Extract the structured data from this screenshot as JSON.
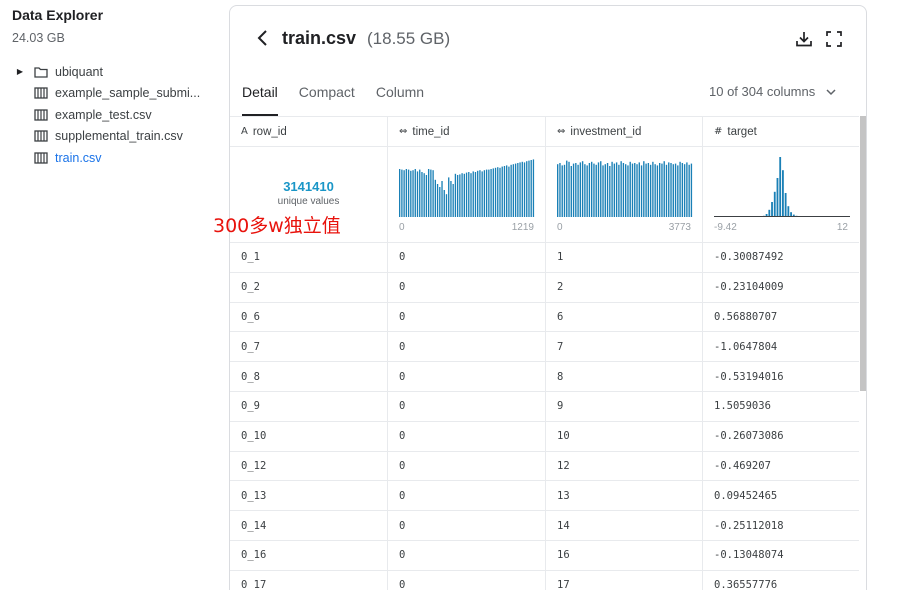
{
  "sidebar": {
    "title": "Data Explorer",
    "size": "24.03 GB",
    "items": [
      {
        "label": "ubiquant",
        "type": "folder"
      },
      {
        "label": "example_sample_submi...",
        "type": "table"
      },
      {
        "label": "example_test.csv",
        "type": "table"
      },
      {
        "label": "supplemental_train.csv",
        "type": "table"
      },
      {
        "label": "train.csv",
        "type": "table",
        "active": true
      }
    ]
  },
  "header": {
    "file_name": "train.csv",
    "file_size": "(18.55 GB)",
    "icons": [
      "back-chevron-icon",
      "download-icon",
      "fullscreen-icon"
    ]
  },
  "tabs": [
    {
      "label": "Detail",
      "active": true
    },
    {
      "label": "Compact",
      "active": false
    },
    {
      "label": "Column",
      "active": false
    }
  ],
  "column_selector": "10 of 304 columns",
  "columns": [
    {
      "type_icon": "A",
      "name": "row_id"
    },
    {
      "type_icon": "⇔",
      "name": "time_id"
    },
    {
      "type_icon": "⇔",
      "name": "investment_id"
    },
    {
      "type_icon": "#",
      "name": "target"
    }
  ],
  "summary": {
    "row_id": {
      "unique_count": "3141410",
      "unique_label": "unique values"
    },
    "time_id": {
      "min": "0",
      "max": "1219",
      "histogram": [
        0.8,
        0.79,
        0.78,
        0.8,
        0.79,
        0.77,
        0.78,
        0.8,
        0.76,
        0.79,
        0.75,
        0.73,
        0.7,
        0.8,
        0.79,
        0.78,
        0.62,
        0.55,
        0.5,
        0.6,
        0.45,
        0.38,
        0.66,
        0.6,
        0.55,
        0.72,
        0.7,
        0.71,
        0.73,
        0.72,
        0.74,
        0.75,
        0.73,
        0.76,
        0.75,
        0.77,
        0.78,
        0.76,
        0.78,
        0.79,
        0.79,
        0.8,
        0.81,
        0.82,
        0.83,
        0.82,
        0.84,
        0.85,
        0.86,
        0.84,
        0.87,
        0.88,
        0.89,
        0.9,
        0.91,
        0.92,
        0.91,
        0.93,
        0.94,
        0.95,
        0.96
      ]
    },
    "investment_id": {
      "min": "0",
      "max": "3773",
      "histogram": [
        0.88,
        0.9,
        0.86,
        0.87,
        0.94,
        0.92,
        0.85,
        0.89,
        0.9,
        0.87,
        0.91,
        0.93,
        0.88,
        0.86,
        0.9,
        0.92,
        0.89,
        0.87,
        0.91,
        0.93,
        0.86,
        0.88,
        0.9,
        0.85,
        0.92,
        0.89,
        0.91,
        0.87,
        0.93,
        0.9,
        0.88,
        0.86,
        0.92,
        0.89,
        0.9,
        0.88,
        0.91,
        0.86,
        0.93,
        0.89,
        0.9,
        0.87,
        0.92,
        0.88,
        0.86,
        0.9,
        0.89,
        0.93,
        0.87,
        0.91,
        0.9,
        0.88,
        0.89,
        0.86,
        0.92,
        0.9,
        0.88,
        0.91,
        0.87,
        0.89
      ]
    },
    "target": {
      "min": "-9.42",
      "max": "12",
      "histogram": [
        0.0,
        0.0,
        0.0,
        0.0,
        0.0,
        0.0,
        0.0,
        0.0,
        0.0,
        0.0,
        0.0,
        0.0,
        0.0,
        0.0,
        0.0,
        0.0,
        0.0,
        0.01,
        0.02,
        0.05,
        0.12,
        0.25,
        0.42,
        0.65,
        1.0,
        0.78,
        0.4,
        0.18,
        0.08,
        0.04,
        0.02,
        0.01,
        0.0,
        0.0,
        0.0,
        0.0,
        0.0,
        0.0,
        0.0,
        0.0,
        0.0,
        0.0,
        0.0,
        0.0,
        0.0,
        0.0,
        0.0,
        0.0,
        0.0,
        0.0
      ]
    }
  },
  "rows": [
    [
      "0_1",
      "0",
      "1",
      "-0.30087492"
    ],
    [
      "0_2",
      "0",
      "2",
      "-0.23104009"
    ],
    [
      "0_6",
      "0",
      "6",
      "0.56880707"
    ],
    [
      "0_7",
      "0",
      "7",
      "-1.0647804"
    ],
    [
      "0_8",
      "0",
      "8",
      "-0.53194016"
    ],
    [
      "0_9",
      "0",
      "9",
      "1.5059036"
    ],
    [
      "0_10",
      "0",
      "10",
      "-0.26073086"
    ],
    [
      "0_12",
      "0",
      "12",
      "-0.469207"
    ],
    [
      "0_13",
      "0",
      "13",
      "0.09452465"
    ],
    [
      "0_14",
      "0",
      "14",
      "-0.25112018"
    ],
    [
      "0_16",
      "0",
      "16",
      "-0.13048074"
    ],
    [
      "0_17",
      "0",
      "17",
      "0.36557776"
    ]
  ],
  "annotation": "300多w独立值",
  "colors": {
    "accent": "#1a96c7",
    "link": "#1a73e8",
    "bar": "#1a80b6",
    "annotation": "#e8120c"
  }
}
